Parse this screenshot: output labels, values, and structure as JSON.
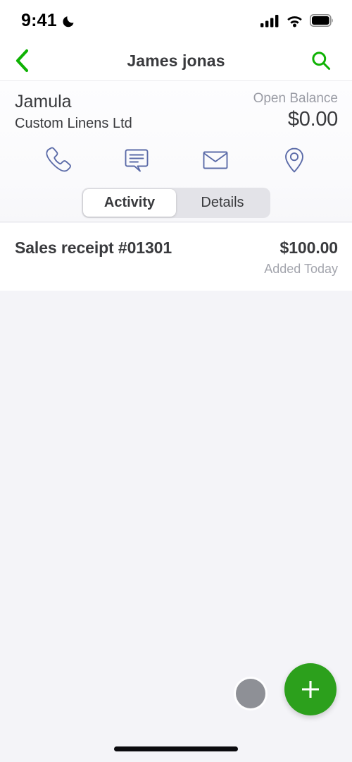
{
  "status_bar": {
    "time": "9:41",
    "dnd_icon": "moon-icon",
    "cellular_icon": "signal-bars-icon",
    "wifi_icon": "wifi-icon",
    "battery_icon": "battery-full-icon"
  },
  "nav_bar": {
    "back_icon": "chevron-left-icon",
    "title": "James jonas",
    "search_icon": "search-icon",
    "accent_color": "#0FB204"
  },
  "customer": {
    "name": "Jamula",
    "company": "Custom Linens Ltd",
    "balance_label": "Open Balance",
    "balance_amount": "$0.00"
  },
  "quick_actions": [
    {
      "name": "call",
      "icon": "phone-icon"
    },
    {
      "name": "message",
      "icon": "message-bubble-icon"
    },
    {
      "name": "email",
      "icon": "envelope-icon"
    },
    {
      "name": "location",
      "icon": "map-pin-icon"
    }
  ],
  "quick_actions_color": "#5B6BA8",
  "segmented_control": {
    "selected": "Activity",
    "options": [
      {
        "label": "Activity",
        "selected": true
      },
      {
        "label": "Details",
        "selected": false
      }
    ]
  },
  "activity": [
    {
      "title": "Sales receipt #01301",
      "amount": "$100.00",
      "subtitle": "Added Today"
    }
  ],
  "fab": {
    "icon": "plus-icon",
    "color": "#2CA01C"
  },
  "home_indicator": "home-indicator-bar"
}
